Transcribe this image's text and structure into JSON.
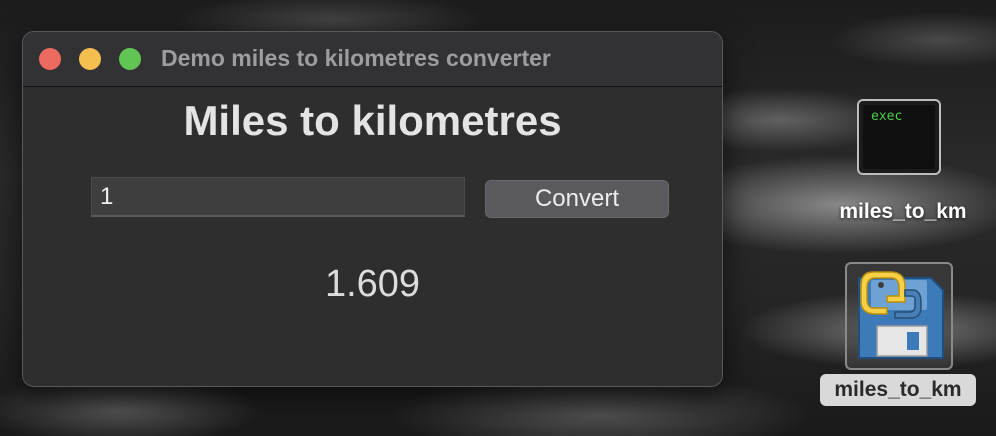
{
  "window": {
    "title": "Demo miles to kilometres converter"
  },
  "app": {
    "heading": "Miles to kilometres",
    "input_value": "1",
    "convert_label": "Convert",
    "result": "1.609"
  },
  "desktop": {
    "icons": [
      {
        "label": "miles_to_km",
        "icon": "exec-terminal-icon",
        "badge_text": "exec"
      },
      {
        "label": "miles_to_km",
        "icon": "python-script-icon",
        "selected": true
      }
    ]
  },
  "colors": {
    "close": "#ed6a5e",
    "minimize": "#f5bf4f",
    "maximize": "#61c554"
  }
}
